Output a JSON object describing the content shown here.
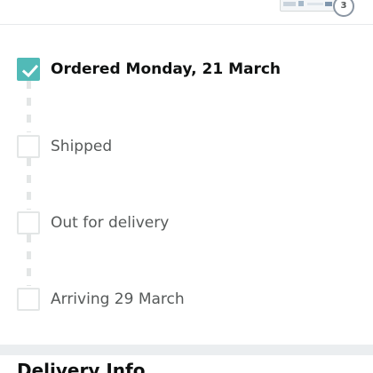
{
  "header": {
    "item_count": "3"
  },
  "tracking": {
    "steps": [
      {
        "label": "Ordered Monday, 21 March",
        "status": "complete"
      },
      {
        "label": "Shipped",
        "status": "pending"
      },
      {
        "label": "Out for delivery",
        "status": "pending"
      },
      {
        "label": "Arriving 29 March",
        "status": "pending"
      }
    ]
  },
  "next_section": {
    "title": "Delivery Info"
  },
  "colors": {
    "complete": "#51bab7",
    "pending_border": "#e3e6e6",
    "text_active": "#0f1111",
    "text_muted": "#565959"
  }
}
